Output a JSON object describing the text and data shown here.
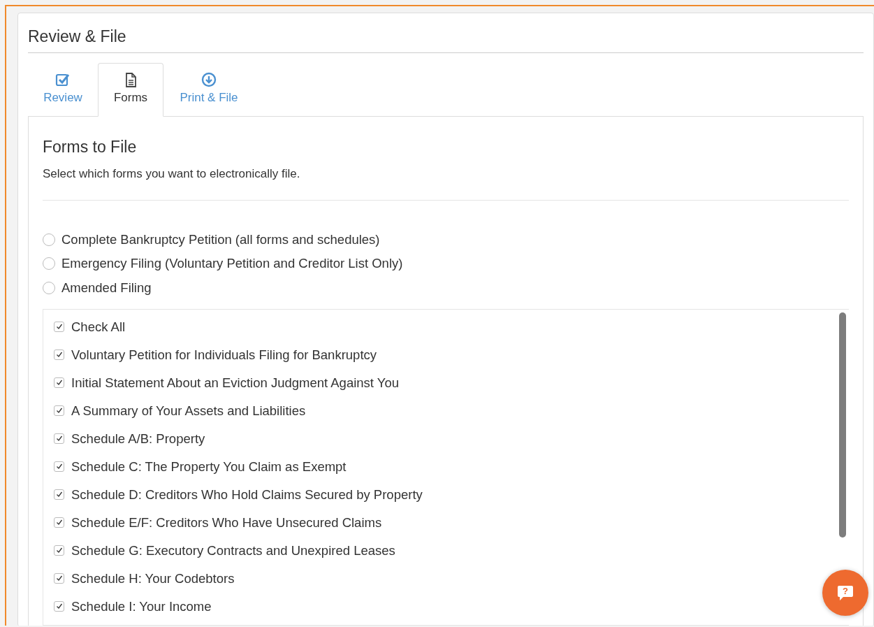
{
  "page": {
    "title": "Review & File"
  },
  "tabs": [
    {
      "label": "Review",
      "selected": false
    },
    {
      "label": "Forms",
      "selected": true
    },
    {
      "label": "Print & File",
      "selected": false
    }
  ],
  "section": {
    "title": "Forms to File",
    "description": "Select which forms you want to electronically file."
  },
  "filing_types": [
    {
      "label": "Complete Bankruptcy Petition (all forms and schedules)",
      "selected": false
    },
    {
      "label": "Emergency Filing (Voluntary Petition and Creditor List Only)",
      "selected": false
    },
    {
      "label": "Amended Filing",
      "selected": false
    }
  ],
  "forms": [
    {
      "label": "Check All",
      "checked": true
    },
    {
      "label": "Voluntary Petition for Individuals Filing for Bankruptcy",
      "checked": true
    },
    {
      "label": "Initial Statement About an Eviction Judgment Against You",
      "checked": true
    },
    {
      "label": "A Summary of Your Assets and Liabilities",
      "checked": true
    },
    {
      "label": "Schedule A/B: Property",
      "checked": true
    },
    {
      "label": "Schedule C: The Property You Claim as Exempt",
      "checked": true
    },
    {
      "label": "Schedule D: Creditors Who Hold Claims Secured by Property",
      "checked": true
    },
    {
      "label": "Schedule E/F: Creditors Who Have Unsecured Claims",
      "checked": true
    },
    {
      "label": "Schedule G: Executory Contracts and Unexpired Leases",
      "checked": true
    },
    {
      "label": "Schedule H: Your Codebtors",
      "checked": true
    },
    {
      "label": "Schedule I: Your Income",
      "checked": true
    }
  ],
  "help_button": {
    "label": "?"
  }
}
